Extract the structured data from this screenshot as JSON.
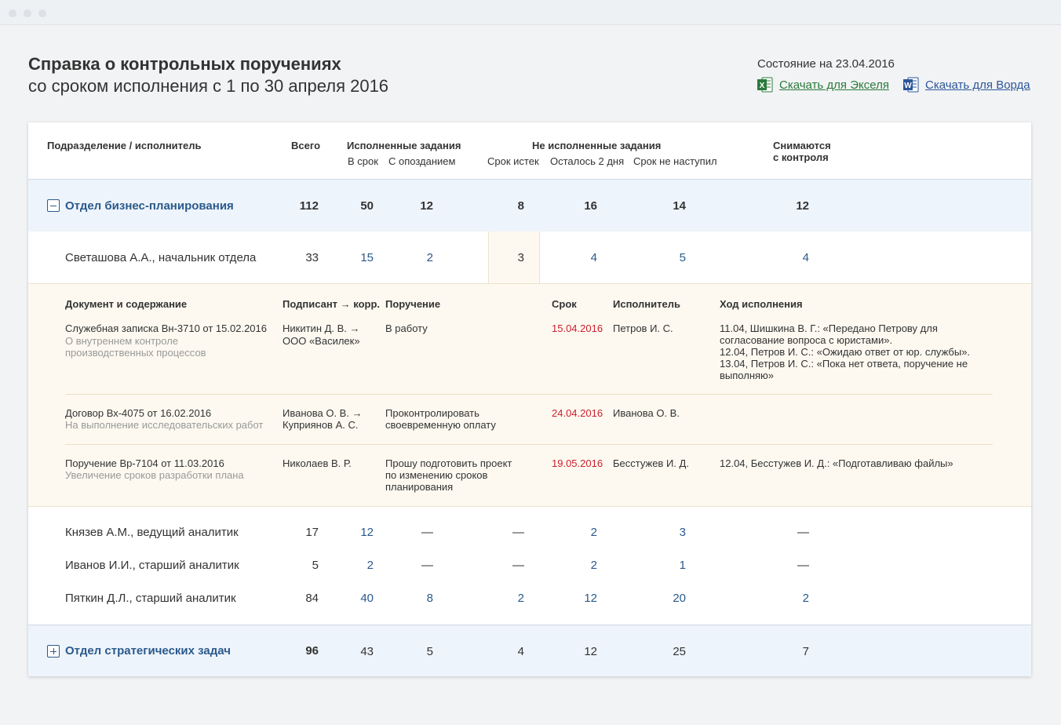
{
  "window": {
    "dots": [
      "close",
      "minimize",
      "maximize"
    ]
  },
  "header": {
    "title": "Справка о контрольных поручениях",
    "subtitle": "со сроком исполнения с 1 по 30 апреля 2016",
    "status": "Состояние на 23.04.2016",
    "download_excel": "Скачать для Экселя",
    "download_word": "Скачать для Ворда"
  },
  "colors": {
    "accent": "#2a5a8c",
    "excel": "#2a7a3b",
    "word": "#2b579a",
    "overdue": "#cc1f2d",
    "detail_bg": "#fdf9f0",
    "dept_bg": "#eef4fb"
  },
  "table": {
    "headers": {
      "unit": "Подразделение / исполнитель",
      "total": "Всего",
      "done": "Исполненные задания",
      "done_ontime": "В срок",
      "done_late": "С опозданием",
      "not_done": "Не исполненные задания",
      "expired": "Срок истек",
      "two_days": "Осталось 2 дня",
      "not_yet": "Срок не наступил",
      "removed_l1": "Снимаются",
      "removed_l2": "с контроля"
    },
    "dept1": {
      "name": "Отдел бизнес-планирования",
      "total": "112",
      "ontime": "50",
      "late": "12",
      "expired": "8",
      "two_days": "16",
      "not_yet": "14",
      "removed": "12"
    },
    "person1": {
      "name": "Светашова А.А., начальник отдела",
      "total": "33",
      "ontime": "15",
      "late": "2",
      "expired": "3",
      "two_days": "4",
      "not_yet": "5",
      "removed": "4"
    },
    "details": {
      "headers": {
        "doc": "Документ и содержание",
        "signer": "Подписант → корр.",
        "order": "Поручение",
        "deadline": "Срок",
        "executor": "Исполнитель",
        "progress": "Ход исполнения"
      },
      "rows": [
        {
          "doc": "Служебная записка Вн-3710 от 15.02.2016",
          "doc_desc_1": "О внутреннем контроле",
          "doc_desc_2": "производственных процессов",
          "signer_1": "Никитин Д. В. →",
          "signer_2": "ООО «Василек»",
          "order_1": "В работу",
          "deadline": "15.04.2016",
          "executor": "Петров И. С.",
          "progress_1": "11.04, Шишкина В. Г.: «Передано Петрову для",
          "progress_2": "согласование вопроса с юристами».",
          "progress_3": "12.04, Петров И. С.: «Ожидаю ответ от юр. службы».",
          "progress_4": "13.04, Петров И. С.: «Пока нет ответа, поручение не",
          "progress_5": "выполняю»"
        },
        {
          "doc": "Договор Вх-4075 от 16.02.2016",
          "doc_desc_1": "На выполнение исследовательских работ",
          "signer_1": "Иванова О. В. →",
          "signer_2": "Куприянов А. С.",
          "order_1": "Проконтролировать",
          "order_2": "своевременную оплату",
          "deadline": "24.04.2016",
          "executor": "Иванова О. В."
        },
        {
          "doc": "Поручение  Вр-7104 от 11.03.2016",
          "doc_desc_1": "Увеличение сроков разработки плана",
          "signer_1": "Николаев В. Р.",
          "order_1": "Прошу подготовить проект",
          "order_2": "по изменению сроков",
          "order_3": "планирования",
          "deadline": "19.05.2016",
          "executor": "Бесстужев И. Д.",
          "progress_1": "12.04, Бесстужев И. Д.: «Подготавливаю файлы»"
        }
      ]
    },
    "persons": [
      {
        "name": "Князев А.М., ведущий аналитик",
        "total": "17",
        "ontime": "12",
        "late": "—",
        "expired": "—",
        "two_days": "2",
        "not_yet": "3",
        "removed": "—"
      },
      {
        "name": "Иванов И.И., старший аналитик",
        "total": "5",
        "ontime": "2",
        "late": "—",
        "expired": "—",
        "two_days": "2",
        "not_yet": "1",
        "removed": "—"
      },
      {
        "name": "Пяткин Д.Л., старший аналитик",
        "total": "84",
        "ontime": "40",
        "late": "8",
        "expired": "2",
        "two_days": "12",
        "not_yet": "20",
        "removed": "2"
      }
    ],
    "dept2": {
      "name": "Отдел стратегических задач",
      "total": "96",
      "ontime": "43",
      "late": "5",
      "expired": "4",
      "two_days": "12",
      "not_yet": "25",
      "removed": "7"
    }
  }
}
